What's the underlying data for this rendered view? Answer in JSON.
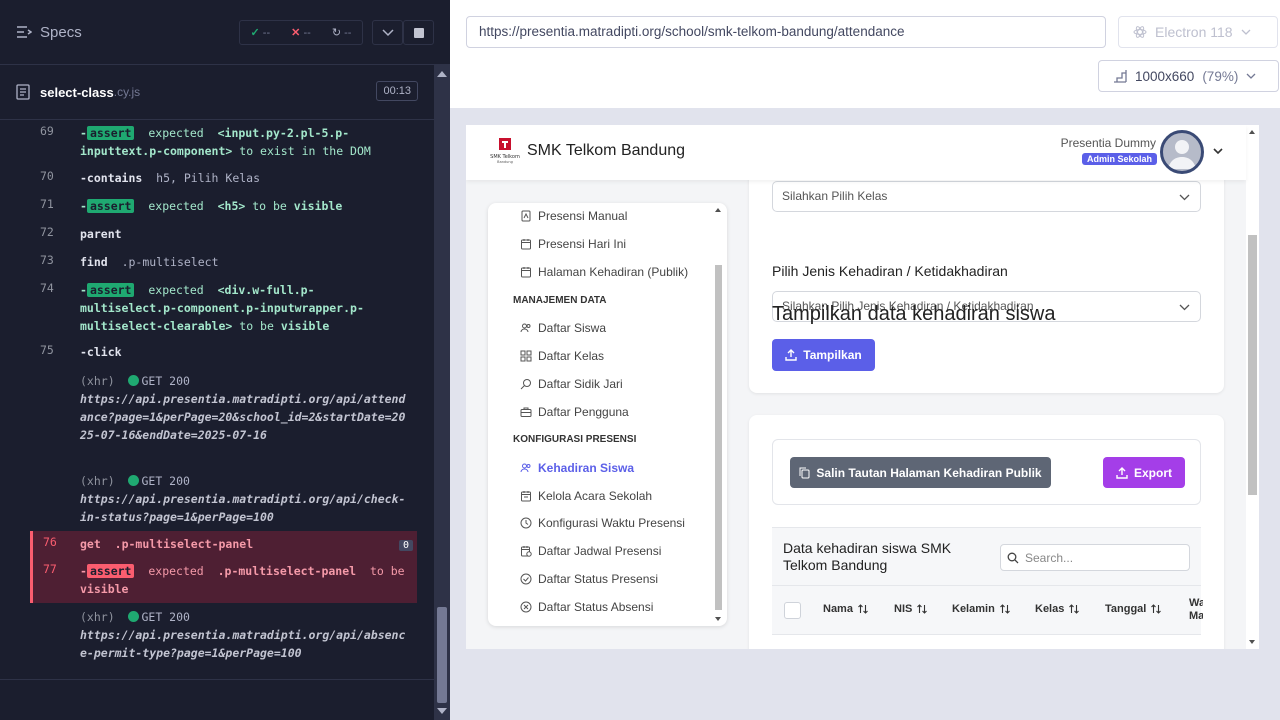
{
  "reporter": {
    "specs_label": "Specs",
    "stats": {
      "passed": "--",
      "failed": "--",
      "pending": "--"
    },
    "spec_file": {
      "name": "select-class",
      "ext": ".cy.js",
      "duration": "00:13"
    },
    "commands": {
      "c69": {
        "num": "69",
        "badge": "assert",
        "text1": "expected",
        "sel": "<input.py-2.pl-5.p-inputtext.p-component>",
        "text2": "to exist in the DOM"
      },
      "c70": {
        "num": "70",
        "name": "-contains",
        "args": "h5, Pilih Kelas"
      },
      "c71": {
        "num": "71",
        "badge": "assert",
        "text1": "expected",
        "sel": "<h5>",
        "text2": "to be",
        "text3": "visible"
      },
      "c72": {
        "num": "72",
        "name": "parent"
      },
      "c73": {
        "num": "73",
        "name": "find",
        "args": ".p-multiselect"
      },
      "c74": {
        "num": "74",
        "badge": "assert",
        "text1": "expected",
        "sel": "<div.w-full.p-multiselect.p-component.p-inputwrapper.p-multiselect-clearable>",
        "text2": "to be",
        "text3": "visible"
      },
      "c75": {
        "num": "75",
        "name": "-click"
      },
      "x1": {
        "kind": "(xhr)",
        "status": "GET 200",
        "url": "https://api.presentia.matradipti.org/api/attendance?page=1&perPage=20&school_id=2&startDate=2025-07-16&endDate=2025-07-16"
      },
      "x2": {
        "kind": "(xhr)",
        "status": "GET 200",
        "url": "https://api.presentia.matradipti.org/api/check-in-status?page=1&perPage=100"
      },
      "c76": {
        "num": "76",
        "name": "get",
        "args": ".p-multiselect-panel",
        "badge": "0"
      },
      "c77": {
        "num": "77",
        "badge": "assert",
        "text1": "expected",
        "sel": ".p-multiselect-panel",
        "text2": "to be",
        "text3": "visible"
      },
      "x3": {
        "kind": "(xhr)",
        "status": "GET 200",
        "url": "https://api.presentia.matradipti.org/api/absence-permit-type?page=1&perPage=100"
      }
    }
  },
  "aut": {
    "url": "https://presentia.matradipti.org/school/smk-telkom-bandung/attendance",
    "browser": "Electron 118",
    "viewport": "1000x660",
    "scale": "(79%)"
  },
  "site": {
    "school_name": "SMK Telkom Bandung",
    "logo_text": "SMK Telkom Bandung",
    "user_name": "Presentia Dummy",
    "role": "Admin Sekolah",
    "sidebar": {
      "items_top": [
        "Presensi Manual",
        "Presensi Hari Ini",
        "Halaman Kehadiran (Publik)"
      ],
      "head1": "MANAJEMEN DATA",
      "items_mid": [
        "Daftar Siswa",
        "Daftar Kelas",
        "Daftar Sidik Jari",
        "Daftar Pengguna"
      ],
      "head2": "KONFIGURASI PRESENSI",
      "items_bottom": [
        "Kehadiran Siswa",
        "Kelola Acara Sekolah",
        "Konfigurasi Waktu Presensi",
        "Daftar Jadwal Presensi",
        "Daftar Status Presensi",
        "Daftar Status Absensi"
      ]
    },
    "form": {
      "class_placeholder": "Silahkan Pilih Kelas",
      "type_label": "Pilih Jenis Kehadiran / Ketidakhadiran",
      "type_placeholder": "Silahkan Pilih Jenis Kehadiran / Ketidakhadiran",
      "section_title": "Tampilkan data kehadiran siswa",
      "show_button": "Tampilkan"
    },
    "table": {
      "copy_button": "Salin Tautan Halaman Kehadiran Publik",
      "export_button": "Export",
      "title": "Data kehadiran siswa SMK Telkom Bandung",
      "search_placeholder": "Search...",
      "columns": [
        "Nama",
        "NIS",
        "Kelamin",
        "Kelas",
        "Tanggal"
      ],
      "cut_column": "Wa Ma"
    }
  }
}
